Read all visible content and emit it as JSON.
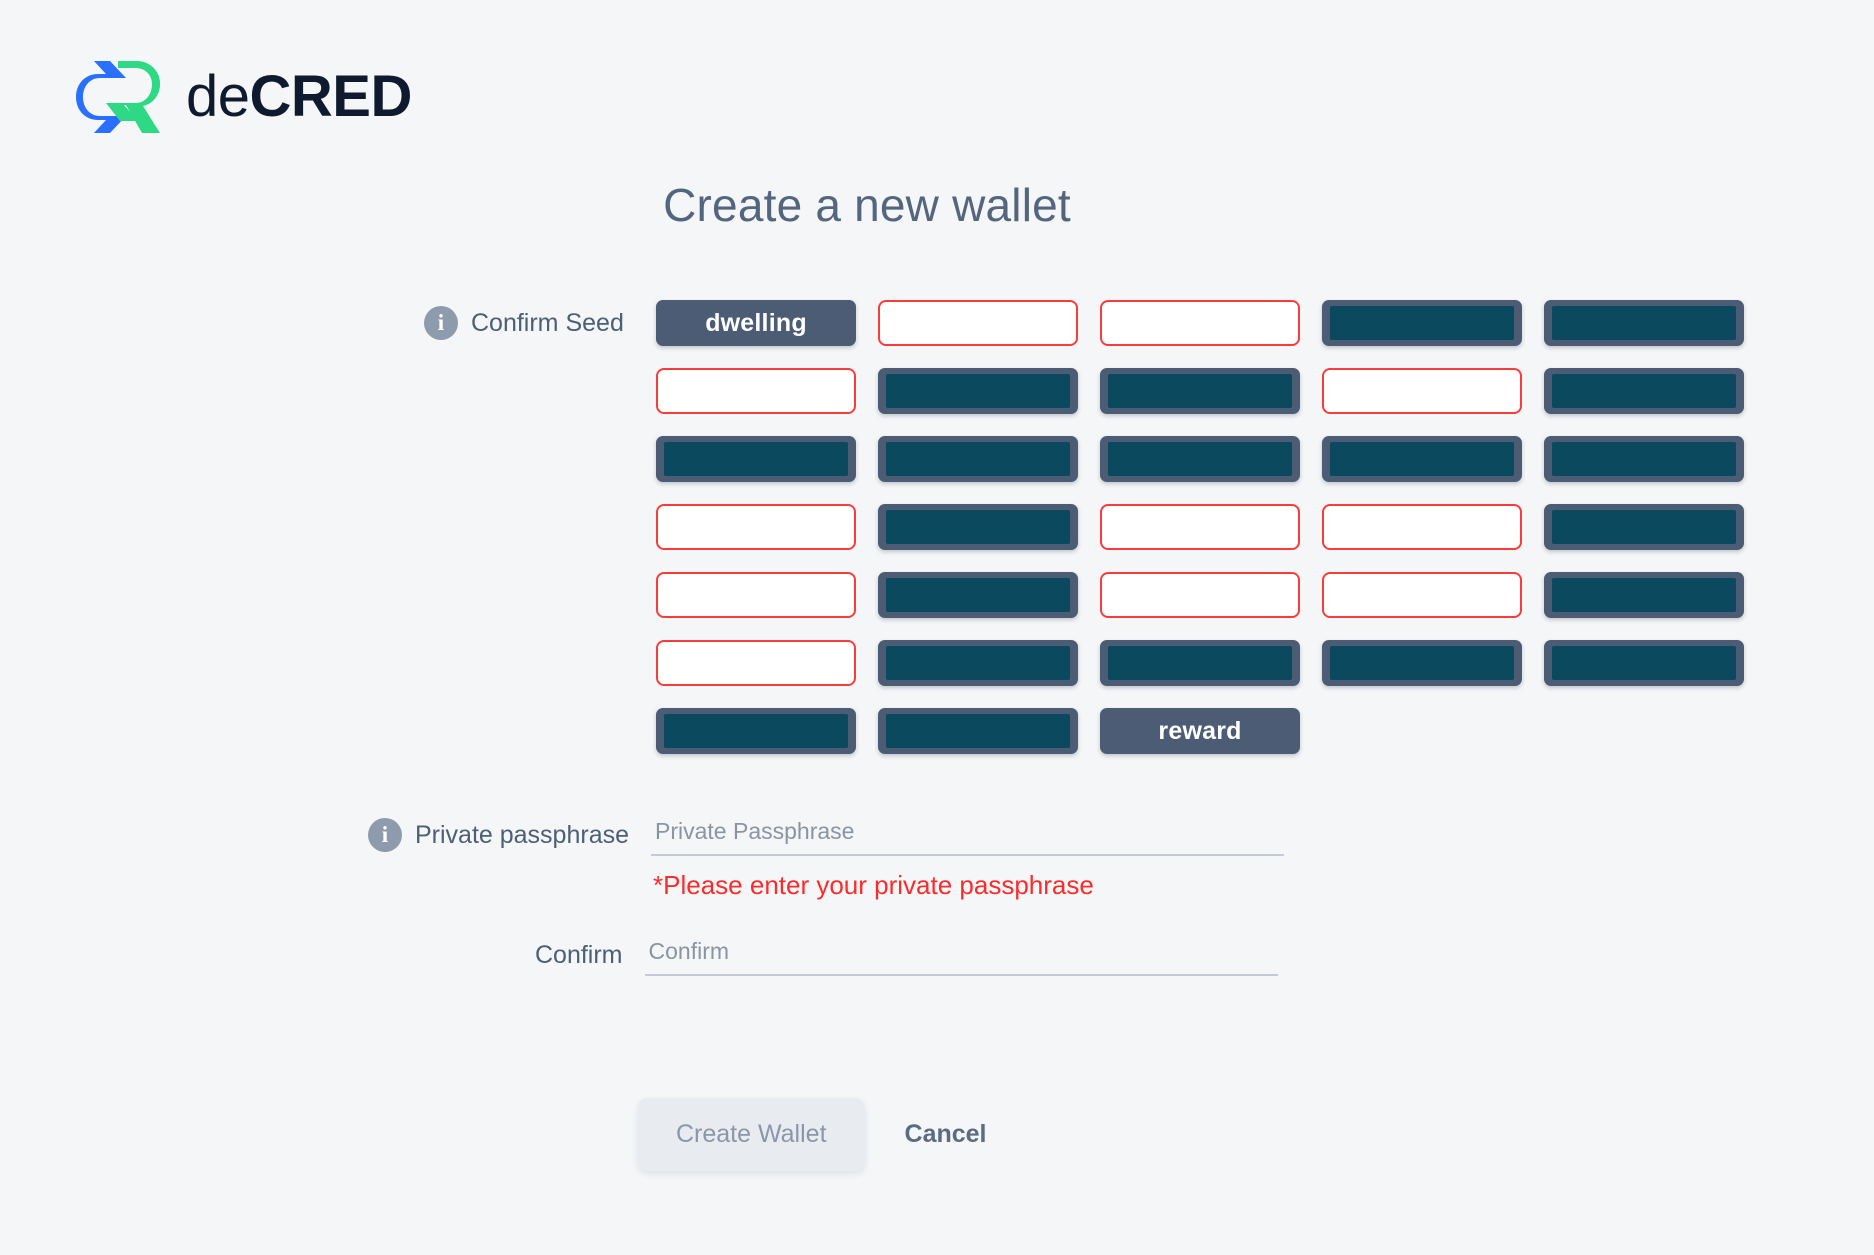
{
  "brand": {
    "logo_icon": "decred-logo-icon",
    "name_light": "de",
    "name_bold": "CRED",
    "color_blue": "#2970ff",
    "color_green": "#2ed884",
    "color_wordmark": "#0f1a2e"
  },
  "header": {
    "title": "Create a new wallet"
  },
  "seed": {
    "label": "Confirm Seed",
    "info_icon": "info-icon",
    "columns": 5,
    "cells": [
      {
        "state": "word",
        "text": "dwelling"
      },
      {
        "state": "empty",
        "text": ""
      },
      {
        "state": "empty",
        "text": ""
      },
      {
        "state": "redacted",
        "text": ""
      },
      {
        "state": "redacted",
        "text": ""
      },
      {
        "state": "empty",
        "text": ""
      },
      {
        "state": "redacted",
        "text": ""
      },
      {
        "state": "redacted",
        "text": ""
      },
      {
        "state": "empty",
        "text": ""
      },
      {
        "state": "redacted",
        "text": ""
      },
      {
        "state": "redacted",
        "text": ""
      },
      {
        "state": "redacted",
        "text": ""
      },
      {
        "state": "redacted",
        "text": ""
      },
      {
        "state": "redacted",
        "text": ""
      },
      {
        "state": "redacted",
        "text": ""
      },
      {
        "state": "empty",
        "text": ""
      },
      {
        "state": "redacted",
        "text": ""
      },
      {
        "state": "empty",
        "text": ""
      },
      {
        "state": "empty",
        "text": ""
      },
      {
        "state": "redacted",
        "text": ""
      },
      {
        "state": "empty",
        "text": ""
      },
      {
        "state": "redacted",
        "text": ""
      },
      {
        "state": "empty",
        "text": ""
      },
      {
        "state": "empty",
        "text": ""
      },
      {
        "state": "redacted",
        "text": ""
      },
      {
        "state": "empty",
        "text": ""
      },
      {
        "state": "redacted",
        "text": ""
      },
      {
        "state": "redacted",
        "text": ""
      },
      {
        "state": "redacted",
        "text": ""
      },
      {
        "state": "redacted",
        "text": ""
      },
      {
        "state": "redacted",
        "text": ""
      },
      {
        "state": "redacted",
        "text": ""
      },
      {
        "state": "word",
        "text": "reward"
      }
    ],
    "colors": {
      "chip": "#4c5c74",
      "redaction": "#0b4a5e",
      "empty_border": "#fc3b3b"
    }
  },
  "passphrase": {
    "label": "Private passphrase",
    "info_icon": "info-icon",
    "placeholder": "Private Passphrase",
    "value": "",
    "error": "*Please enter your private passphrase",
    "error_color": "#fb2c2c"
  },
  "confirm": {
    "label": "Confirm",
    "placeholder": "Confirm",
    "value": ""
  },
  "actions": {
    "create_label": "Create Wallet",
    "cancel_label": "Cancel"
  }
}
